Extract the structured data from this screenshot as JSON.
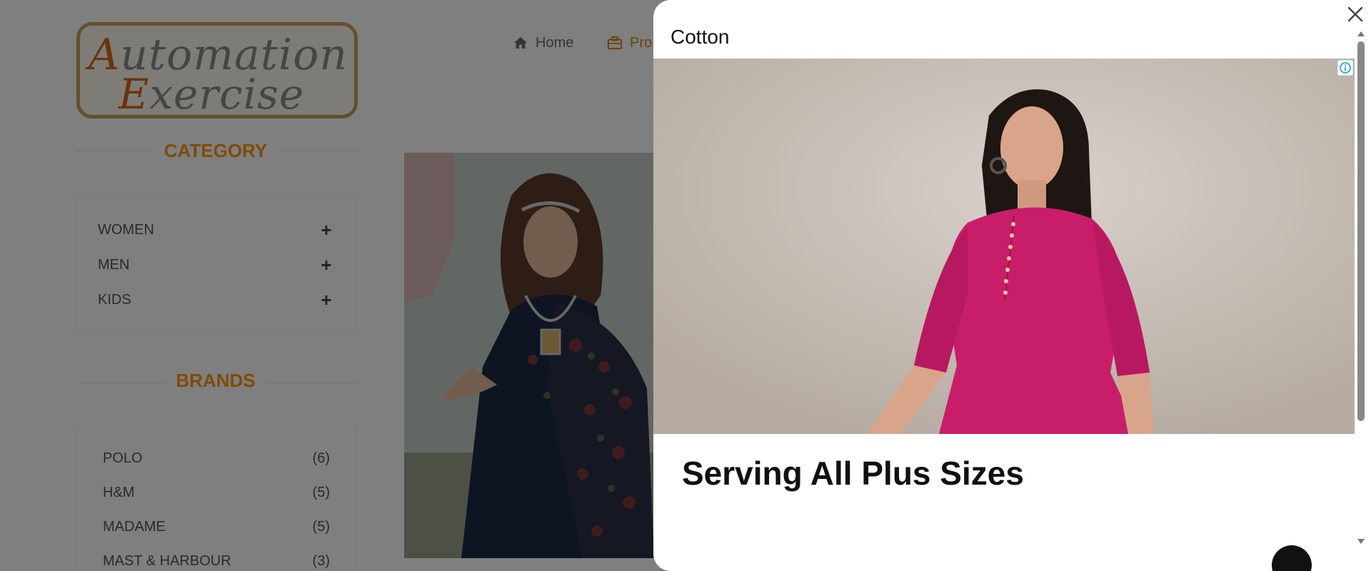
{
  "logo": {
    "line1_cap": "A",
    "line1_rest": "utomation",
    "line2_cap": "E",
    "line2_rest": "xercise"
  },
  "nav": [
    {
      "label": "Home",
      "icon": "home-icon"
    },
    {
      "label": "Pro",
      "icon": "briefcase-icon"
    }
  ],
  "sidebar": {
    "category_title": "CATEGORY",
    "categories": [
      {
        "label": "WOMEN",
        "icon": "plus-icon"
      },
      {
        "label": "MEN",
        "icon": "plus-icon"
      },
      {
        "label": "KIDS",
        "icon": "plus-icon"
      }
    ],
    "brands_title": "BRANDS",
    "brands": [
      {
        "label": "POLO",
        "count": "(6)"
      },
      {
        "label": "H&M",
        "count": "(5)"
      },
      {
        "label": "MADAME",
        "count": "(5)"
      },
      {
        "label": "MAST & HARBOUR",
        "count": "(3)"
      }
    ]
  },
  "ad_modal": {
    "title": "Cotton",
    "headline": "Serving All Plus Sizes",
    "close_icon": "close-icon",
    "info_icon": "info-icon"
  },
  "colors": {
    "accent": "#fe980f",
    "overlay": "rgba(0,0,0,0.5)",
    "kurta": "#c81e6a"
  }
}
